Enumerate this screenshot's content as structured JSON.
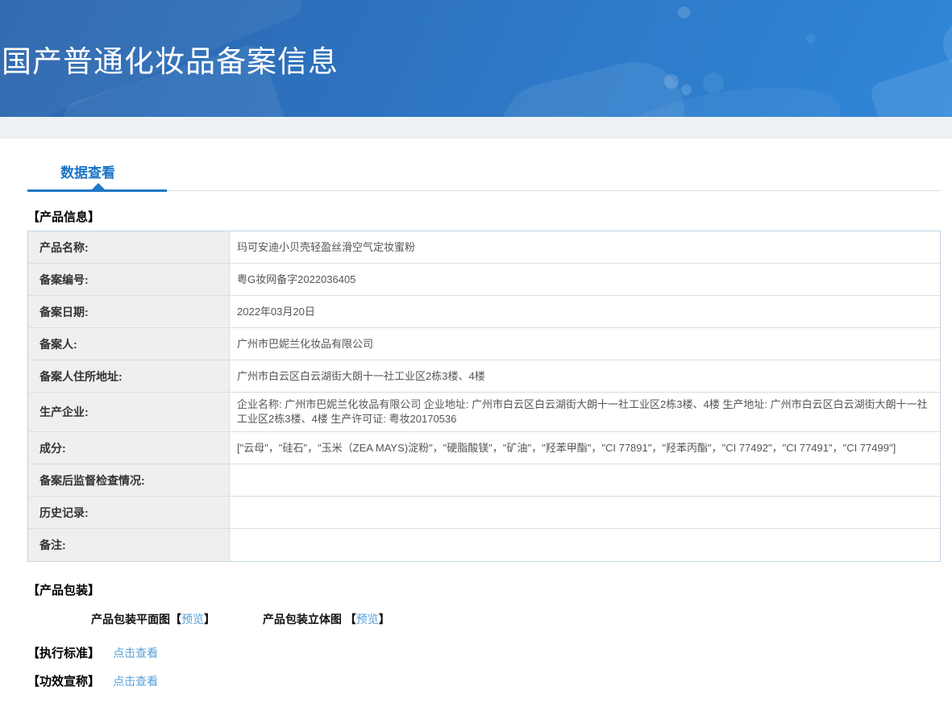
{
  "header": {
    "title": "国产普通化妆品备案信息"
  },
  "tabs": {
    "data_view_label": "数据查看"
  },
  "product_info": {
    "section_title": "【产品信息】",
    "rows": [
      {
        "label": "产品名称:",
        "value": "玛可安迪小贝壳轻盈丝滑空气定妆蜜粉"
      },
      {
        "label": "备案编号:",
        "value": "粤G妆网备字2022036405"
      },
      {
        "label": "备案日期:",
        "value": "2022年03月20日"
      },
      {
        "label": "备案人:",
        "value": "广州市巴妮兰化妆品有限公司"
      },
      {
        "label": "备案人住所地址:",
        "value": "广州市白云区白云湖街大朗十一社工业区2栋3楼、4楼"
      },
      {
        "label": "生产企业:",
        "value": "企业名称: 广州市巴妮兰化妆品有限公司 企业地址: 广州市白云区白云湖街大朗十一社工业区2栋3楼、4楼 生产地址: 广州市白云区白云湖街大朗十一社工业区2栋3楼、4楼 生产许可证: 粤妆20170536"
      },
      {
        "label": "成分:",
        "value": "[\"云母\"，\"硅石\"，\"玉米（ZEA MAYS)淀粉\"，\"硬脂酸镁\"，\"矿油\"，\"羟苯甲酯\"，\"CI 77891\"，\"羟苯丙酯\"，\"CI 77492\"，\"CI 77491\"，\"CI 77499\"]"
      },
      {
        "label": "备案后监督检查情况:",
        "value": ""
      },
      {
        "label": "历史记录:",
        "value": ""
      },
      {
        "label": "备注:",
        "value": ""
      }
    ]
  },
  "packaging": {
    "section_title": "【产品包装】",
    "flat_label": "产品包装平面图",
    "stereo_label": "产品包装立体图 ",
    "bracket_open": "【",
    "bracket_close": "】",
    "preview_label": "预览"
  },
  "standard": {
    "section_title": "【执行标准】",
    "link_label": "点击查看"
  },
  "efficacy": {
    "section_title": "【功效宣称】",
    "link_label": "点击查看"
  },
  "colors": {
    "banner_gradient_start": "#2b64ac",
    "banner_gradient_end": "#2f87d8",
    "tab_blue": "#1a74c4",
    "underline_blue": "#1e78c8",
    "link_blue": "#57a0d9",
    "label_cell_bg": "#efefef",
    "table_border": "#c2d4e2",
    "row_border": "#dddddd",
    "sub_strip_bg": "#eef1f4"
  }
}
